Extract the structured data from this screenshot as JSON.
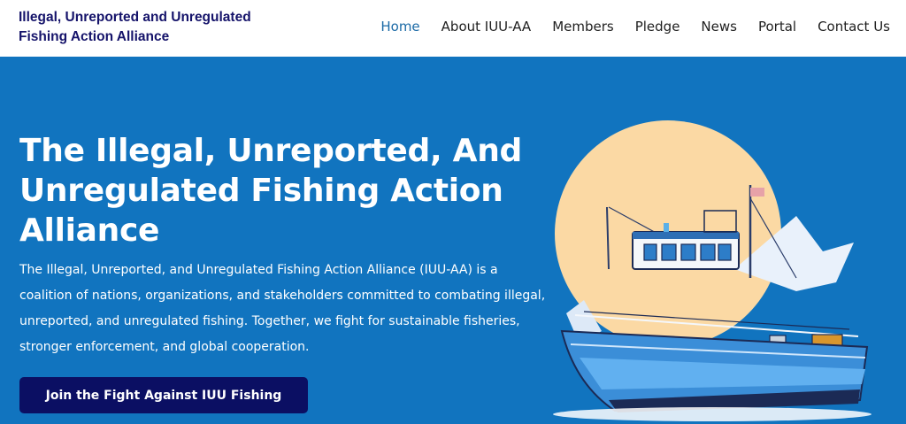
{
  "brand": {
    "line1": "Illegal, Unreported and Unregulated",
    "line2": "Fishing Action Alliance"
  },
  "nav": {
    "items": [
      {
        "label": "Home",
        "active": true
      },
      {
        "label": "About IUU-AA"
      },
      {
        "label": "Members"
      },
      {
        "label": "Pledge"
      },
      {
        "label": "News"
      },
      {
        "label": "Portal"
      },
      {
        "label": "Contact Us"
      }
    ]
  },
  "hero": {
    "title": "The Illegal, Unreported, And Unregulated Fishing Action Alliance",
    "description": "The Illegal, Unreported, and Unregulated Fishing Action Alliance (IUU-AA) is a coalition of nations, organizations, and stakeholders committed to combating illegal, unreported, and unregulated fishing. Together, we fight for sustainable fisheries, stronger enforcement, and global cooperation.",
    "cta_label": "Join the Fight Against IUU Fishing",
    "illustration_icon": "fishing-boat-illustration"
  },
  "colors": {
    "hero_bg": "#1174bf",
    "brand_text": "#15136a",
    "active_nav": "#1b6aa6",
    "cta_bg": "#0b0f63",
    "sun": "#fbd9a4"
  }
}
